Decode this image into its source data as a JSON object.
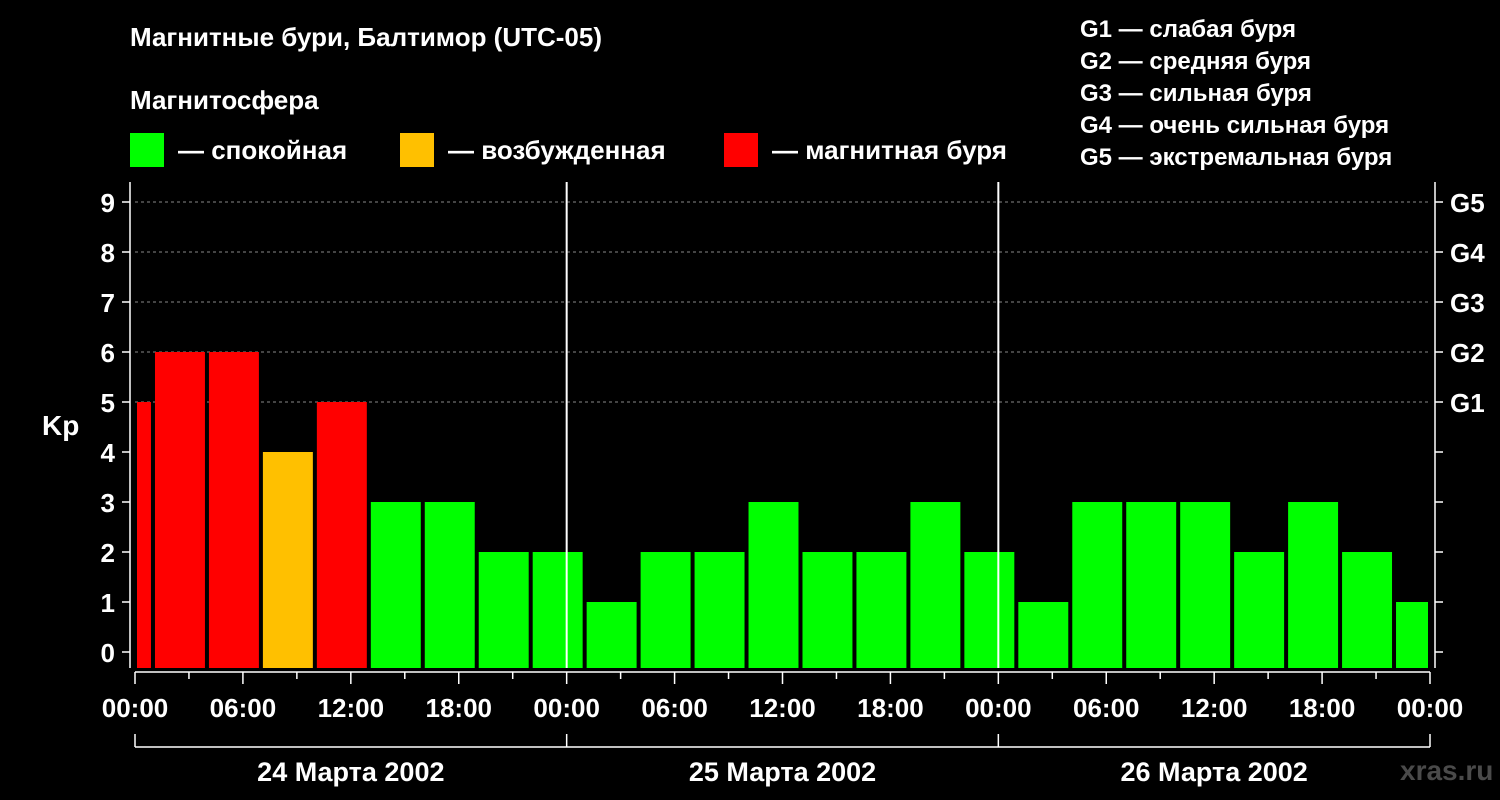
{
  "title": "Магнитные бури, Балтимор (UTC-05)",
  "subtitle": "Магнитосфера",
  "legend": [
    {
      "color": "#00ff00",
      "label": "— спокойная"
    },
    {
      "color": "#ffc000",
      "label": "— возбужденная"
    },
    {
      "color": "#ff0000",
      "label": "— магнитная буря"
    }
  ],
  "g_scale": [
    "G1 — слабая буря",
    "G2 — средняя буря",
    "G3 — сильная буря",
    "G4 — очень сильная буря",
    "G5 — экстремальная буря"
  ],
  "watermark": "xras.ru",
  "chart_data": {
    "type": "bar",
    "ylabel": "Kp",
    "xlabel": "",
    "ylim": [
      0,
      9
    ],
    "yticks": [
      0,
      1,
      2,
      3,
      4,
      5,
      6,
      7,
      8,
      9
    ],
    "right_axis_labels": [
      {
        "value": 5,
        "label": "G1"
      },
      {
        "value": 6,
        "label": "G2"
      },
      {
        "value": 7,
        "label": "G3"
      },
      {
        "value": 8,
        "label": "G4"
      },
      {
        "value": 9,
        "label": "G5"
      }
    ],
    "grid": "horizontal dashed at 5–9",
    "hour_labels": [
      "00:00",
      "06:00",
      "12:00",
      "18:00",
      "00:00",
      "06:00",
      "12:00",
      "18:00",
      "00:00",
      "06:00",
      "12:00",
      "18:00",
      "00:00"
    ],
    "days": [
      "24 Марта 2002",
      "25 Марта 2002",
      "26 Марта 2002"
    ],
    "x_unit": "hours from 24 Марта 2002 00:00 (UTC-05)",
    "bars": [
      {
        "start": 0,
        "end": 1,
        "kp": 5
      },
      {
        "start": 1,
        "end": 4,
        "kp": 6
      },
      {
        "start": 4,
        "end": 7,
        "kp": 6
      },
      {
        "start": 7,
        "end": 10,
        "kp": 4
      },
      {
        "start": 10,
        "end": 13,
        "kp": 5
      },
      {
        "start": 13,
        "end": 16,
        "kp": 3
      },
      {
        "start": 16,
        "end": 19,
        "kp": 3
      },
      {
        "start": 19,
        "end": 22,
        "kp": 2
      },
      {
        "start": 22,
        "end": 25,
        "kp": 2
      },
      {
        "start": 25,
        "end": 28,
        "kp": 1
      },
      {
        "start": 28,
        "end": 31,
        "kp": 2
      },
      {
        "start": 31,
        "end": 34,
        "kp": 2
      },
      {
        "start": 34,
        "end": 37,
        "kp": 3
      },
      {
        "start": 37,
        "end": 40,
        "kp": 2
      },
      {
        "start": 40,
        "end": 43,
        "kp": 2
      },
      {
        "start": 43,
        "end": 46,
        "kp": 3
      },
      {
        "start": 46,
        "end": 49,
        "kp": 2
      },
      {
        "start": 49,
        "end": 52,
        "kp": 1
      },
      {
        "start": 52,
        "end": 55,
        "kp": 3
      },
      {
        "start": 55,
        "end": 58,
        "kp": 3
      },
      {
        "start": 58,
        "end": 61,
        "kp": 3
      },
      {
        "start": 61,
        "end": 64,
        "kp": 2
      },
      {
        "start": 64,
        "end": 67,
        "kp": 3
      },
      {
        "start": 67,
        "end": 70,
        "kp": 2
      },
      {
        "start": 70,
        "end": 72,
        "kp": 1
      }
    ],
    "colors": {
      "quiet": "#00ff00",
      "active": "#ffc000",
      "storm": "#ff0000"
    }
  }
}
